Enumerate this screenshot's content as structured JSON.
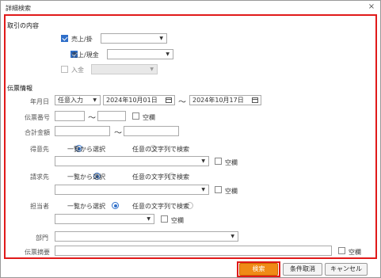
{
  "window": {
    "title": "詳細検索",
    "close_symbol": "×"
  },
  "trade": {
    "title": "取引の内容",
    "items": [
      {
        "label": "売上/掛",
        "checked": true
      },
      {
        "label": "売上/現金",
        "checked": true
      },
      {
        "label": "入金",
        "checked": false
      }
    ]
  },
  "slip": {
    "title": "伝票情報",
    "date_label": "年月日",
    "date_mode": "任意入力",
    "date_from": "2024年10月01日",
    "date_to": "2024年10月17日",
    "tilde": "～",
    "number_label": "伝票番号",
    "amount_label": "合計金額",
    "empty_label": "空欄",
    "client_label": "得意先",
    "billing_label": "請求先",
    "staff_label": "担当者",
    "dept_label": "部門",
    "memo_label": "伝票摘要",
    "radio_list": "一覧から選択",
    "radio_text": "任意の文字列で検索"
  },
  "footer": {
    "search": "検索",
    "clear": "条件取消",
    "cancel": "キャンセル"
  },
  "colors": {
    "accent": "#f08a16",
    "highlight": "#e01a1a",
    "check": "#2f6fc9"
  }
}
